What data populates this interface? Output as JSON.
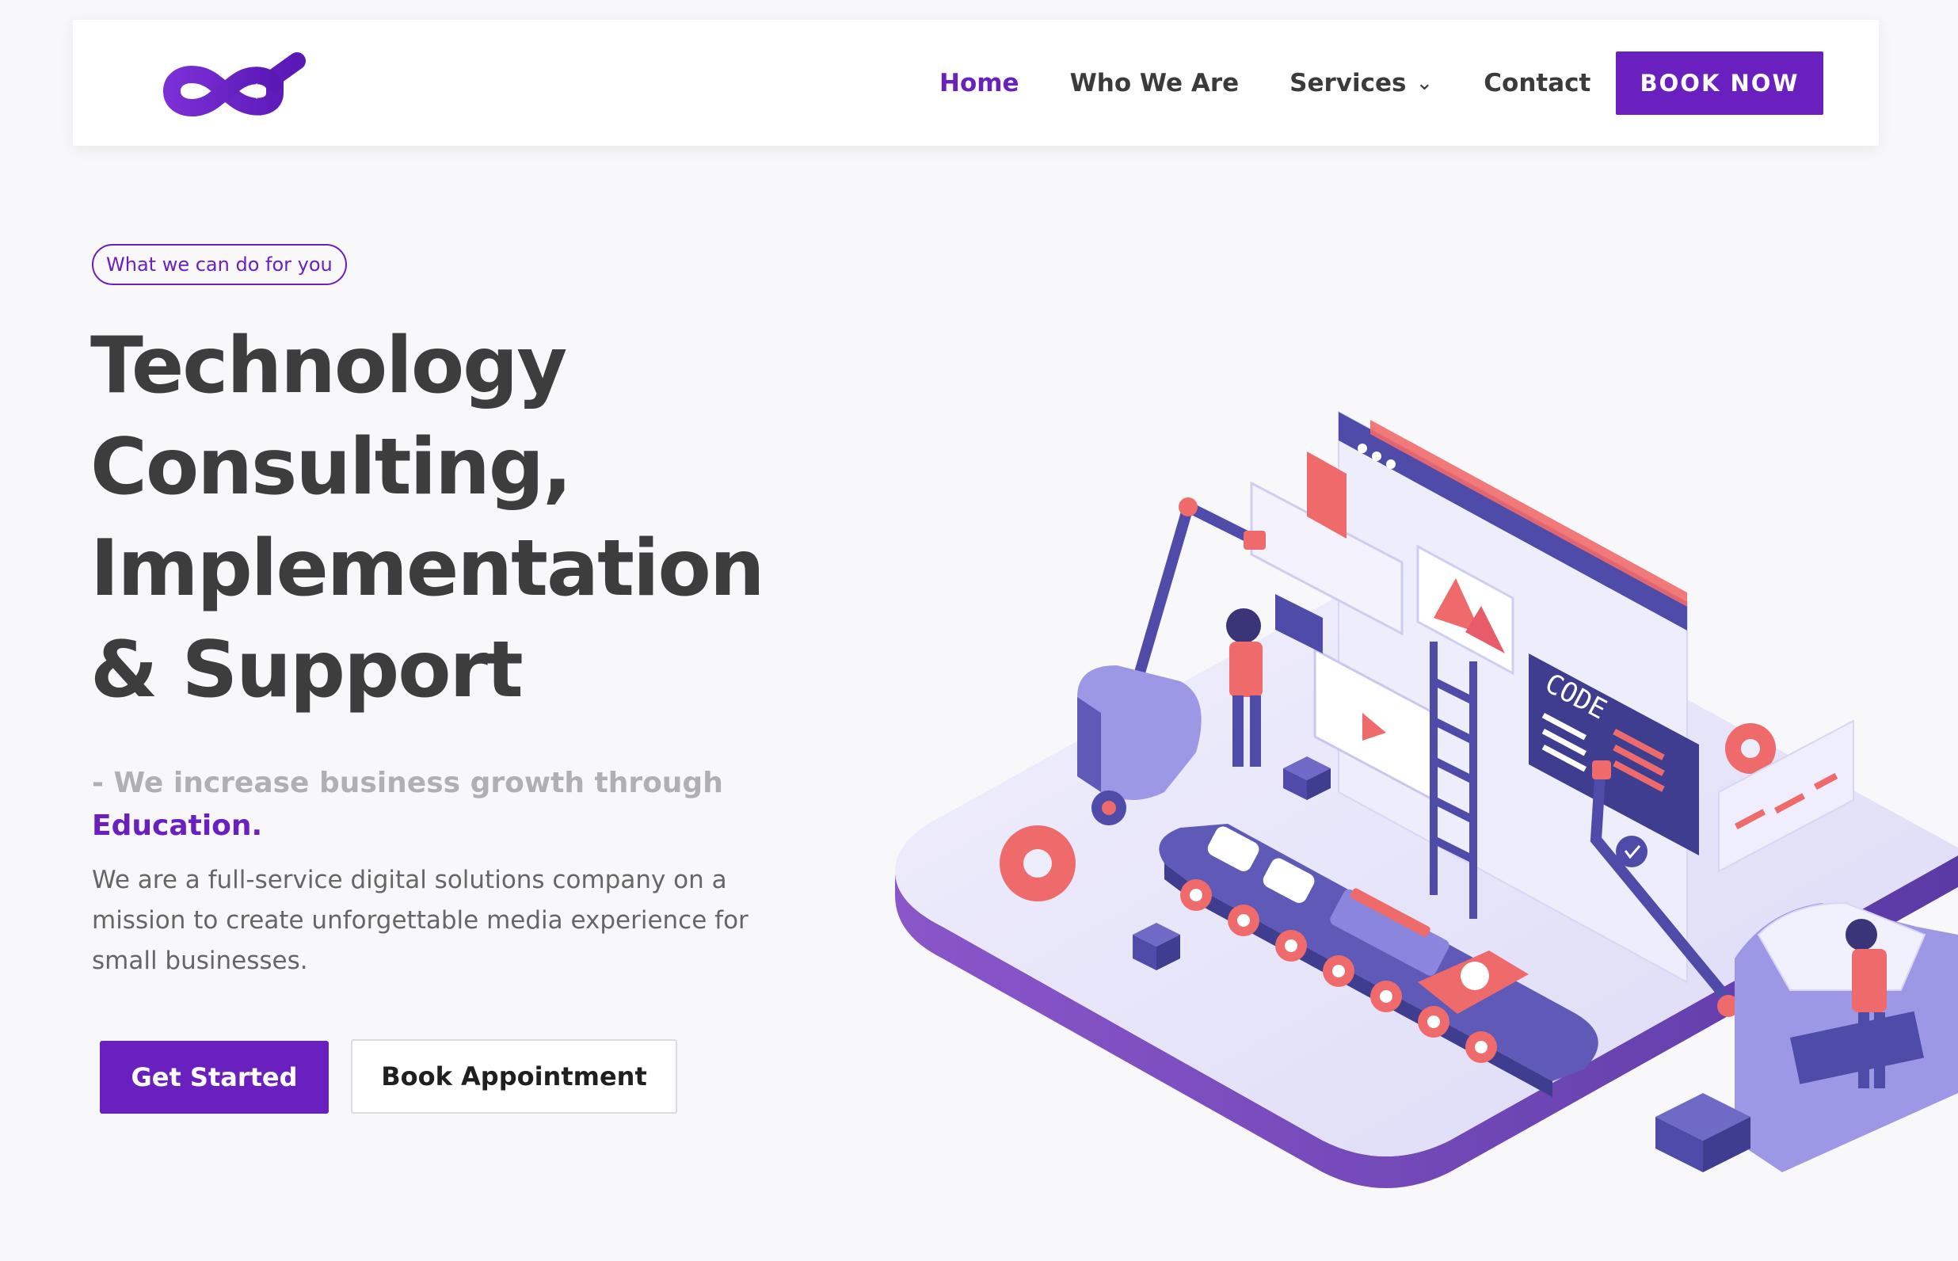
{
  "nav": {
    "logo_icon": "infinity-logo-icon",
    "items": [
      {
        "label": "Home",
        "active": true
      },
      {
        "label": "Who We Are",
        "active": false
      },
      {
        "label": "Services",
        "active": false,
        "has_dropdown": true
      },
      {
        "label": "Contact",
        "active": false
      }
    ],
    "dropdown_caret": "⌄",
    "cta_label": "BOOK NOW"
  },
  "hero": {
    "badge": "What we can do for you",
    "headline_lines": [
      "Technology",
      "Consulting,",
      "Implementation",
      "& Support"
    ],
    "tagline_prefix": "- We increase business growth through",
    "tagline_accent": "Education.",
    "description": "We are a full-service digital solutions company on a mission to create unforgettable media experience for small businesses.",
    "primary_button": "Get Started",
    "secondary_button": "Book Appointment",
    "illustration": {
      "icon": "isometric-tech-factory-illustration",
      "code_panel_label": "CODE"
    }
  },
  "colors": {
    "accent": "#6a1fbf",
    "heading": "#3d3d3d",
    "muted": "#b0b0b3",
    "body_text": "#666666",
    "illustration_lavender": "#e6e4fb",
    "illustration_coral": "#ef6a6a",
    "illustration_indigo": "#4f4ba8"
  }
}
